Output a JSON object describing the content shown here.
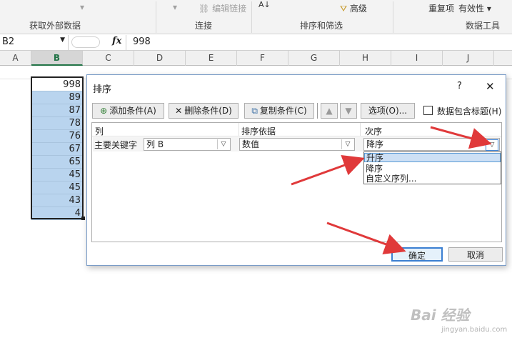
{
  "ribbon": {
    "group_external": "获取外部数据",
    "group_connections": "连接",
    "edit_links": "编辑链接",
    "group_sort_filter": "排序和筛选",
    "advanced": "高级",
    "duplicates": "重复项",
    "validity": "有效性",
    "group_data_tools": "数据工具"
  },
  "formula_bar": {
    "name_box": "B2",
    "fx": "fx",
    "value": "998"
  },
  "columns": [
    "A",
    "B",
    "C",
    "D",
    "E",
    "F",
    "G",
    "H",
    "I",
    "J"
  ],
  "selected_column": "B",
  "cells_b": [
    "998",
    "89",
    "87",
    "78",
    "76",
    "67",
    "65",
    "45",
    "45",
    "43",
    "4"
  ],
  "dialog": {
    "title": "排序",
    "help": "?",
    "close": "✕",
    "add_condition": "添加条件(A)",
    "delete_condition": "删除条件(D)",
    "copy_condition": "复制条件(C)",
    "options": "选项(O)...",
    "has_header": "数据包含标题(H)",
    "header_column": "列",
    "header_sort_on": "排序依据",
    "header_order": "次序",
    "row_label": "主要关键字",
    "column_value": "列 B",
    "sort_on_value": "数值",
    "order_value": "降序",
    "order_options": [
      "升序",
      "降序",
      "自定义序列..."
    ],
    "ok": "确定",
    "cancel": "取消"
  },
  "watermark": {
    "brand": "Bai 经验",
    "site": "jingyan.baidu.com"
  },
  "colors": {
    "selection_fill": "#b9d4ee",
    "excel_green": "#217346",
    "arrow_red": "#e0393a"
  }
}
